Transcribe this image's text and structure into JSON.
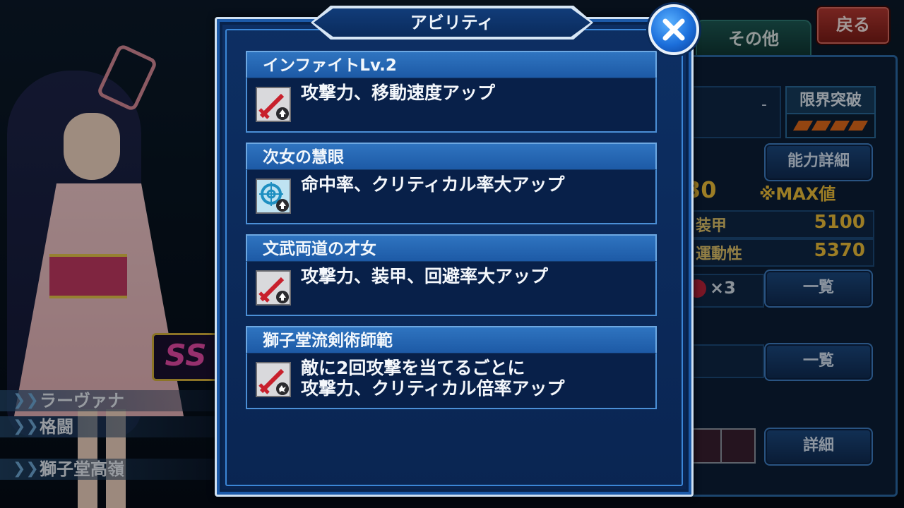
{
  "window": {
    "title": "アビリティ"
  },
  "top_bar": {
    "back_label": "戻る",
    "tab_other_label": "その他"
  },
  "character": {
    "name": "ラーヴァナ",
    "type": "格闘",
    "pilot": "獅子堂高嶺",
    "rank_badge": "SS"
  },
  "background_panel": {
    "dash_value": "-",
    "limit_break_label": "限界突破",
    "limit_break_level": 4,
    "ability_detail_button": "能力詳細",
    "level_partial": "30",
    "max_note": "※MAX値",
    "stats": [
      {
        "label": "装甲",
        "value": "5100"
      },
      {
        "label": "運動性",
        "value": "5370"
      }
    ],
    "count_text": "×3",
    "list_button_1": "一覧",
    "list_button_2": "一覧",
    "detail_button": "詳細"
  },
  "abilities": [
    {
      "name": "インファイトLv.2",
      "description": "攻撃力、移動速度アップ",
      "icon": "sword-up-icon"
    },
    {
      "name": "次女の慧眼",
      "description": "命中率、クリティカル率大アップ",
      "icon": "target-up-icon"
    },
    {
      "name": "文武両道の才女",
      "description": "攻撃力、装甲、回避率大アップ",
      "icon": "sword-up-icon"
    },
    {
      "name": "獅子堂流剣術師範",
      "description": "敵に2回攻撃を当てるごとに\n攻撃力、クリティカル倍率アップ",
      "icon": "sword-hit-icon"
    }
  ],
  "colors": {
    "accent_blue": "#1c6fdb",
    "gold": "#f0c13a",
    "red_button": "#b83a33"
  }
}
